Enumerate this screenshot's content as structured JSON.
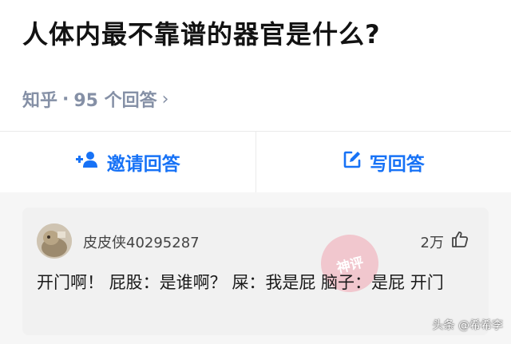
{
  "question": {
    "title": "人体内最不靠谱的器官是什么?",
    "source": "知乎",
    "separator": "·",
    "answer_count": "95 个回答",
    "chevron": "›"
  },
  "actions": {
    "invite_label": "邀请回答",
    "invite_icon": "add-person-icon",
    "write_label": "写回答",
    "write_icon": "edit-icon",
    "accent": "#1772f6"
  },
  "comment": {
    "username": "皮皮侠40295287",
    "likes": "2万",
    "text": "开门啊！ 屁股：是谁啊？ 屎：我是屁 脑子：是屁 开门",
    "stamp_text": "神评"
  },
  "watermark": "头条 @希希李"
}
